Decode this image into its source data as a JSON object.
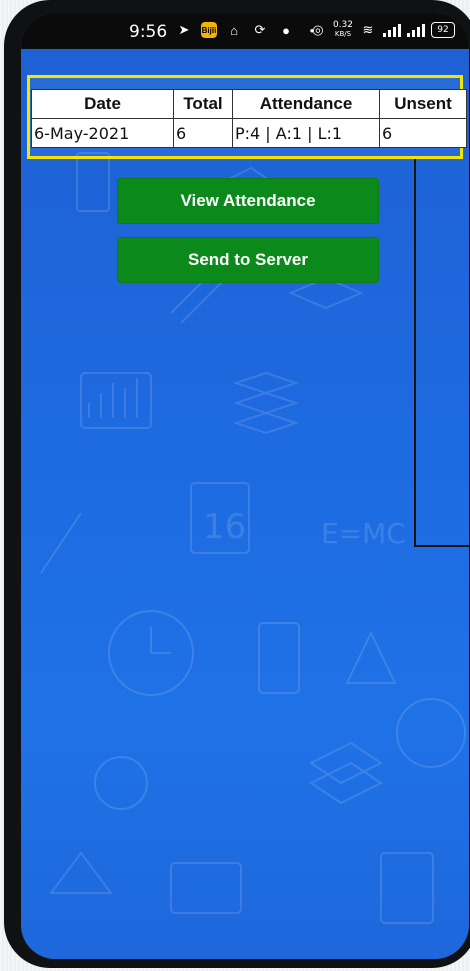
{
  "status_bar": {
    "time": "9:56",
    "network_speed_value": "0.32",
    "network_speed_unit": "KB/S",
    "battery": "92",
    "app_badge": "Bijli"
  },
  "table": {
    "headers": [
      "Date",
      "Total",
      "Attendance",
      "Unsent"
    ],
    "rows": [
      [
        "6-May-2021",
        "6",
        "P:4 | A:1 | L:1",
        "6"
      ]
    ]
  },
  "buttons": {
    "view_attendance": "View Attendance",
    "send_to_server": "Send to Server"
  },
  "colors": {
    "background": "#1e6ae0",
    "button": "#0b8a1b",
    "highlight": "#f5e400"
  }
}
